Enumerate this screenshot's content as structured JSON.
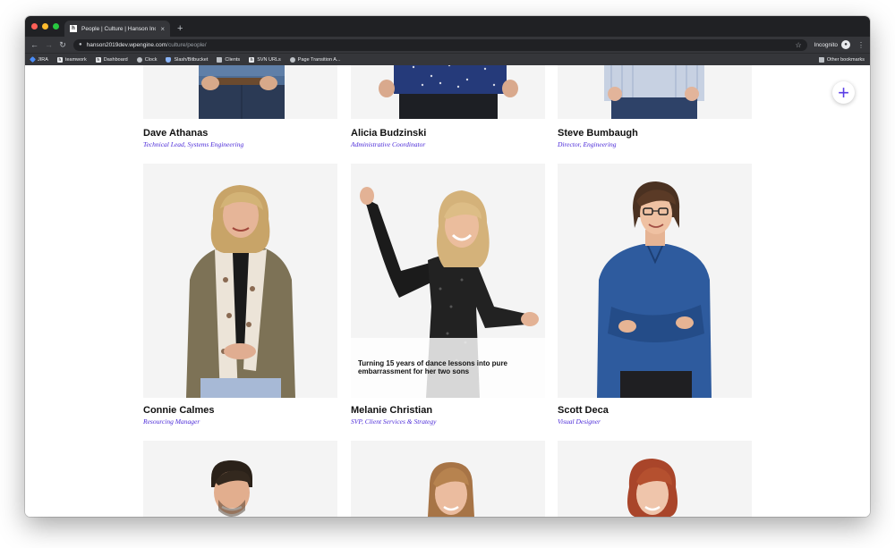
{
  "browser": {
    "tab_title": "People | Culture | Hanson Inc.",
    "tab_favicon": "h",
    "tab_close": "×",
    "new_tab": "+",
    "url_host": "hanson2019dev.wpengine.com",
    "url_path": "/culture/people/",
    "incognito_label": "Incognito",
    "bookmarks": [
      {
        "label": "JIRA",
        "icon": "jira-icon"
      },
      {
        "label": "teamwork",
        "icon": "h-icon"
      },
      {
        "label": "Dashboard",
        "icon": "h-icon"
      },
      {
        "label": "Clock",
        "icon": "clock-icon"
      },
      {
        "label": "Slash/Bitbucket",
        "icon": "shield-icon"
      },
      {
        "label": "Clients",
        "icon": "folder-icon"
      },
      {
        "label": "SVN URLs",
        "icon": "h-icon"
      },
      {
        "label": "Page Transition A...",
        "icon": "gear-icon"
      }
    ],
    "other_bookmarks": "Other bookmarks"
  },
  "colors": {
    "role_text": "#4b2ad8",
    "fab_plus": "#5a3ee6",
    "photo_bg": "#f4f4f4"
  },
  "people": [
    {
      "name": "Dave Athanas",
      "role": "Technical Lead, Systems Engineering"
    },
    {
      "name": "Alicia Budzinski",
      "role": "Administrative Coordinator"
    },
    {
      "name": "Steve Bumbaugh",
      "role": "Director, Engineering"
    },
    {
      "name": "Connie Calmes",
      "role": "Resourcing Manager"
    },
    {
      "name": "Melanie Christian",
      "role": "SVP, Client Services & Strategy",
      "caption": "Turning 15 years of dance lessons into pure embarrassment for her two sons"
    },
    {
      "name": "Scott Deca",
      "role": "Visual Designer"
    }
  ],
  "fab": {
    "label": "+",
    "icon": "plus-icon"
  }
}
